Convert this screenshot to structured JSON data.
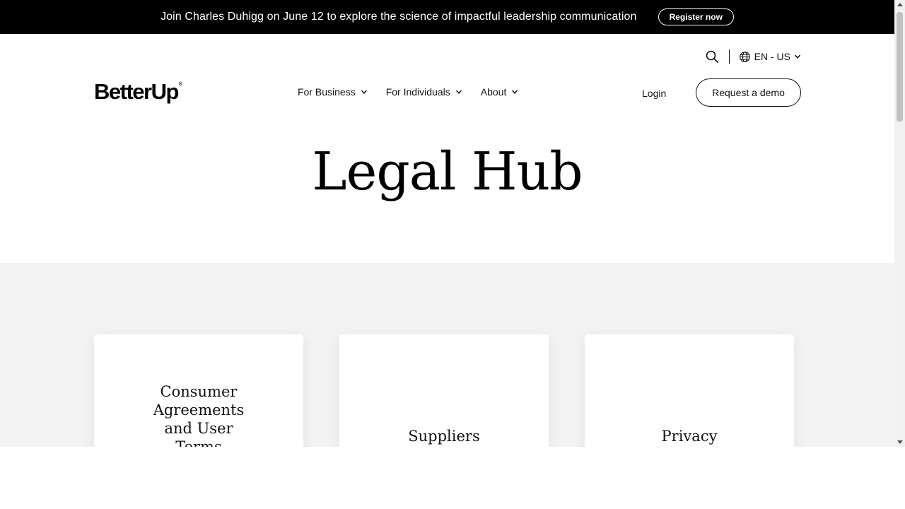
{
  "promo": {
    "text": "Join Charles Duhigg on June 12 to explore the science of impactful leadership communication",
    "button_label": "Register now"
  },
  "utility": {
    "search_icon": "search-icon",
    "locale_label": "EN - US"
  },
  "brand": {
    "logo_text": "BetterUp",
    "logo_mark": "®"
  },
  "nav": {
    "items": [
      {
        "label": "For Business"
      },
      {
        "label": "For Individuals"
      },
      {
        "label": "About"
      }
    ],
    "login_label": "Login",
    "demo_label": "Request a demo"
  },
  "hero": {
    "title": "Legal Hub"
  },
  "cards": [
    {
      "title": "Consumer Agreements and User Terms"
    },
    {
      "title": "Suppliers"
    },
    {
      "title": "Privacy"
    }
  ],
  "colors": {
    "promo_bg": "#000000",
    "section_bg": "#f3f3f3",
    "text": "#111111"
  }
}
